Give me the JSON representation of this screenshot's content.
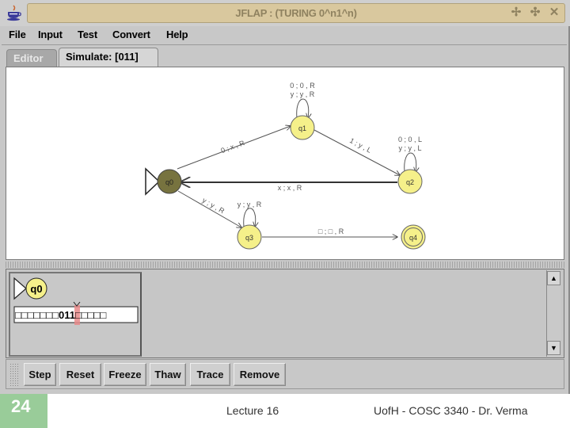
{
  "window": {
    "title": "JFLAP : (TURING 0^n1^n)",
    "icon": "java-cup-icon",
    "controls": [
      {
        "name": "minimize-icon",
        "glyph": "✢"
      },
      {
        "name": "maximize-icon",
        "glyph": "✣"
      },
      {
        "name": "close-icon",
        "glyph": "✕"
      }
    ]
  },
  "menubar": {
    "items": [
      {
        "label": "File"
      },
      {
        "label": "Input"
      },
      {
        "label": "Test"
      },
      {
        "label": "Convert"
      },
      {
        "label": "Help"
      }
    ]
  },
  "tabs": [
    {
      "label": "Editor",
      "active": false
    },
    {
      "label": "Simulate: [011]",
      "active": true
    }
  ],
  "automaton": {
    "states": [
      {
        "id": "q0",
        "label": "q0",
        "initial": true,
        "final": false,
        "highlighted": true
      },
      {
        "id": "q1",
        "label": "q1",
        "initial": false,
        "final": false,
        "highlighted": false
      },
      {
        "id": "q2",
        "label": "q2",
        "initial": false,
        "final": false,
        "highlighted": false
      },
      {
        "id": "q3",
        "label": "q3",
        "initial": false,
        "final": false,
        "highlighted": false
      },
      {
        "id": "q4",
        "label": "q4",
        "initial": false,
        "final": true,
        "highlighted": false
      }
    ],
    "transitions": [
      {
        "from": "q0",
        "to": "q1",
        "label": "0 ; x , R"
      },
      {
        "from": "q1",
        "to": "q1",
        "label": [
          "0 ; 0 , R",
          "y ; y , R"
        ]
      },
      {
        "from": "q1",
        "to": "q2",
        "label": "1 ; y , L"
      },
      {
        "from": "q2",
        "to": "q2",
        "label": [
          "0 ; 0 , L",
          "y ; y , L"
        ]
      },
      {
        "from": "q2",
        "to": "q0",
        "label": "x ; x , R"
      },
      {
        "from": "q0",
        "to": "q3",
        "label": "y ; y , R"
      },
      {
        "from": "q3",
        "to": "q3",
        "label": "y ; y , R"
      },
      {
        "from": "q3",
        "to": "q4",
        "label": "□ ; □ , R"
      }
    ],
    "colors": {
      "state_fill": "#f5f08a",
      "active_state_fill": "#77733f",
      "edge": "#444444",
      "label": "#555555"
    }
  },
  "simulator": {
    "configuration": {
      "state": "q0",
      "tape_left": "□□□□□□□",
      "tape_head": "0",
      "tape_right": "11□□□□□",
      "head_color": "#e88a8a"
    },
    "scroll_up": "▲",
    "scroll_down": "▼",
    "buttons": [
      {
        "label": "Step"
      },
      {
        "label": "Reset"
      },
      {
        "label": "Freeze"
      },
      {
        "label": "Thaw"
      },
      {
        "label": "Trace"
      },
      {
        "label": "Remove"
      }
    ]
  },
  "footer": {
    "slide_number": "24",
    "lecture": "Lecture 16",
    "course": "UofH - COSC 3340 - Dr. Verma"
  }
}
